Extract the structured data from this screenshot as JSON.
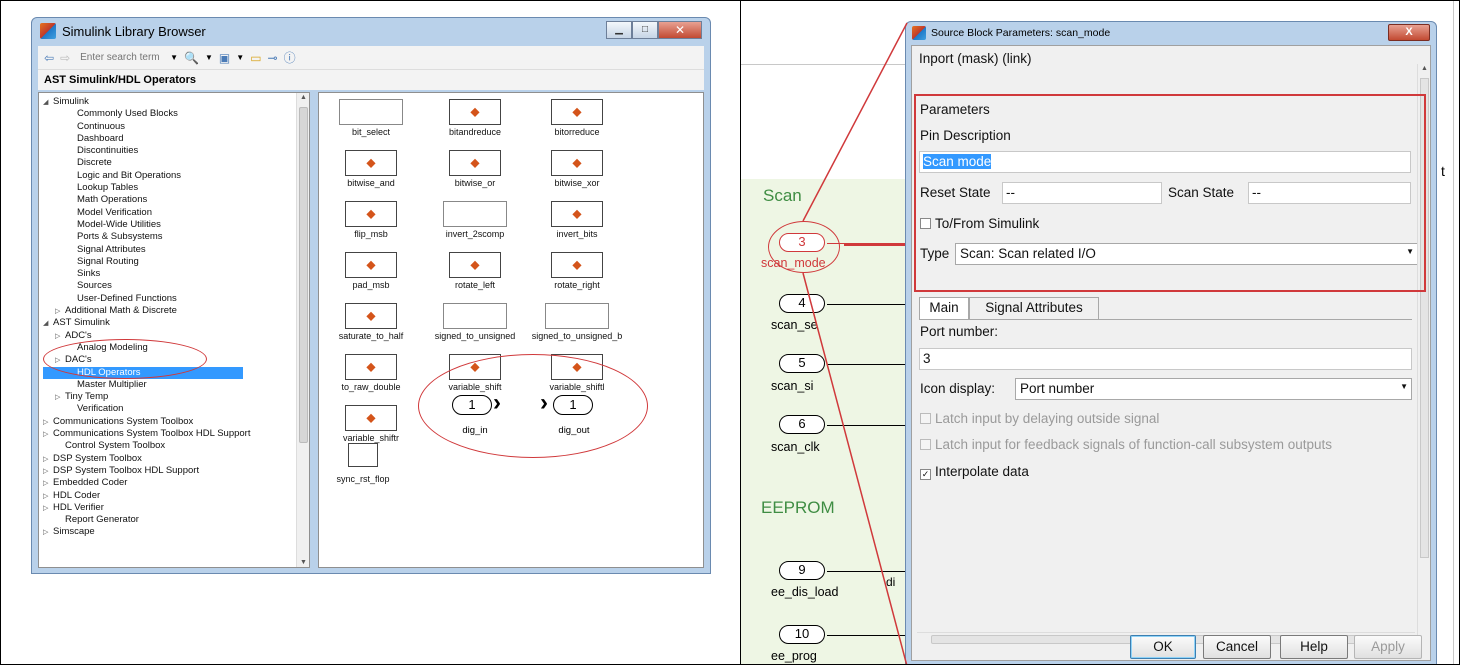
{
  "library_browser": {
    "title": "Simulink Library Browser",
    "search_placeholder": "Enter search term",
    "path": "AST Simulink/HDL Operators",
    "tree": [
      {
        "label": "Simulink",
        "twisty": "◢",
        "indent": 0
      },
      {
        "label": "Commonly Used Blocks",
        "indent": 2
      },
      {
        "label": "Continuous",
        "indent": 2
      },
      {
        "label": "Dashboard",
        "indent": 2
      },
      {
        "label": "Discontinuities",
        "indent": 2
      },
      {
        "label": "Discrete",
        "indent": 2
      },
      {
        "label": "Logic and Bit Operations",
        "indent": 2
      },
      {
        "label": "Lookup Tables",
        "indent": 2
      },
      {
        "label": "Math Operations",
        "indent": 2
      },
      {
        "label": "Model Verification",
        "indent": 2
      },
      {
        "label": "Model-Wide Utilities",
        "indent": 2
      },
      {
        "label": "Ports & Subsystems",
        "indent": 2
      },
      {
        "label": "Signal Attributes",
        "indent": 2
      },
      {
        "label": "Signal Routing",
        "indent": 2
      },
      {
        "label": "Sinks",
        "indent": 2
      },
      {
        "label": "Sources",
        "indent": 2
      },
      {
        "label": "User-Defined Functions",
        "indent": 2
      },
      {
        "label": "Additional Math & Discrete",
        "twisty": "▷",
        "indent": 1
      },
      {
        "label": "AST Simulink",
        "twisty": "◢",
        "indent": 0
      },
      {
        "label": "ADC's",
        "twisty": "▷",
        "indent": 1
      },
      {
        "label": "Analog Modeling",
        "indent": 2
      },
      {
        "label": "DAC's",
        "twisty": "▷",
        "indent": 1
      },
      {
        "label": "HDL Operators",
        "indent": 2,
        "selected": true
      },
      {
        "label": "Master Multiplier",
        "indent": 2
      },
      {
        "label": "Tiny Temp",
        "twisty": "▷",
        "indent": 1
      },
      {
        "label": "Verification",
        "indent": 2
      },
      {
        "label": "Communications System Toolbox",
        "twisty": "▷",
        "indent": 0
      },
      {
        "label": "Communications System Toolbox HDL Support",
        "twisty": "▷",
        "indent": 0
      },
      {
        "label": "Control System Toolbox",
        "indent": 1
      },
      {
        "label": "DSP System Toolbox",
        "twisty": "▷",
        "indent": 0
      },
      {
        "label": "DSP System Toolbox HDL Support",
        "twisty": "▷",
        "indent": 0
      },
      {
        "label": "Embedded Coder",
        "twisty": "▷",
        "indent": 0
      },
      {
        "label": "HDL Coder",
        "twisty": "▷",
        "indent": 0
      },
      {
        "label": "HDL Verifier",
        "twisty": "▷",
        "indent": 0
      },
      {
        "label": "Report Generator",
        "indent": 1
      },
      {
        "label": "Simscape",
        "twisty": "▷",
        "indent": 0
      }
    ],
    "blocks": [
      {
        "name": "bit_select",
        "kind": "wide"
      },
      {
        "name": "bitandreduce",
        "kind": "fcn"
      },
      {
        "name": "bitorreduce",
        "kind": "fcn"
      },
      {
        "name": "bitwise_and",
        "kind": "fcn"
      },
      {
        "name": "bitwise_or",
        "kind": "fcn"
      },
      {
        "name": "bitwise_xor",
        "kind": "fcn"
      },
      {
        "name": "flip_msb",
        "kind": "fcn"
      },
      {
        "name": "invert_2scomp",
        "kind": "wide"
      },
      {
        "name": "invert_bits",
        "kind": "fcn"
      },
      {
        "name": "pad_msb",
        "kind": "fcn"
      },
      {
        "name": "rotate_left",
        "kind": "fcn"
      },
      {
        "name": "rotate_right",
        "kind": "fcn"
      },
      {
        "name": "saturate_to_half",
        "kind": "fcn"
      },
      {
        "name": "signed_to_unsigned",
        "kind": "wide"
      },
      {
        "name": "signed_to_unsigned_b",
        "kind": "wide"
      },
      {
        "name": "to_raw_double",
        "kind": "fcn"
      },
      {
        "name": "variable_shift",
        "kind": "fcn"
      },
      {
        "name": "variable_shiftl",
        "kind": "fcn"
      },
      {
        "name": "variable_shiftr",
        "kind": "fcn"
      }
    ],
    "sync_block": "sync_rst_flop",
    "dig_in": {
      "num": "1",
      "name": "dig_in"
    },
    "dig_out": {
      "num": "1",
      "name": "dig_out"
    }
  },
  "model": {
    "group_scan": "Scan",
    "group_eeprom": "EEPROM",
    "ports": [
      {
        "num": "3",
        "name": "scan_mode",
        "highlight": true
      },
      {
        "num": "4",
        "name": "scan_se"
      },
      {
        "num": "5",
        "name": "scan_si"
      },
      {
        "num": "6",
        "name": "scan_clk"
      },
      {
        "num": "9",
        "name": "ee_dis_load"
      },
      {
        "num": "10",
        "name": "ee_prog"
      }
    ],
    "partial_label": "di",
    "partial_t": "t"
  },
  "dialog": {
    "title": "Source Block Parameters: scan_mode",
    "close": "X",
    "header": "Inport (mask) (link)",
    "params_label": "Parameters",
    "pin_desc_label": "Pin Description",
    "pin_desc_value": "Scan mode",
    "reset_state_label": "Reset State",
    "reset_state_value": "--",
    "scan_state_label": "Scan State",
    "scan_state_value": "--",
    "to_from_label": "To/From Simulink",
    "type_label": "Type",
    "type_value": "Scan: Scan related I/O",
    "tab_main": "Main",
    "tab_signal": "Signal Attributes",
    "port_number_label": "Port number:",
    "port_number_value": "3",
    "icon_display_label": "Icon display:",
    "icon_display_value": "Port number",
    "latch_outside": "Latch input by delaying outside signal",
    "latch_feedback": "Latch input for feedback signals of function-call subsystem outputs",
    "interpolate": "Interpolate data",
    "ok": "OK",
    "cancel": "Cancel",
    "help": "Help",
    "apply": "Apply"
  },
  "colors": {
    "annotation": "#d0393b",
    "selection": "#3399ff",
    "window_frame": "#b9d1ea"
  }
}
